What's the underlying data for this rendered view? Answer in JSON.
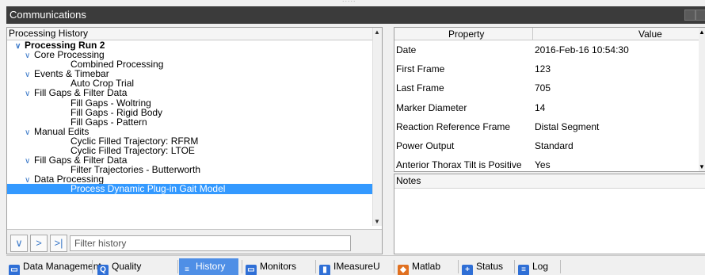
{
  "window": {
    "title": "Communications"
  },
  "history": {
    "header": "Processing History",
    "rows": [
      {
        "label": "Processing Run 2",
        "level": 0,
        "expand": true,
        "bold": true
      },
      {
        "label": "Core Processing",
        "level": 1,
        "expand": true
      },
      {
        "label": "Combined Processing",
        "level": 2
      },
      {
        "label": "Events & Timebar",
        "level": 1,
        "expand": true
      },
      {
        "label": "Auto Crop Trial",
        "level": 2
      },
      {
        "label": "Fill Gaps & Filter Data",
        "level": 1,
        "expand": true
      },
      {
        "label": "Fill Gaps - Woltring",
        "level": 2
      },
      {
        "label": "Fill Gaps - Rigid Body",
        "level": 2
      },
      {
        "label": "Fill Gaps - Pattern",
        "level": 2
      },
      {
        "label": "Manual Edits",
        "level": 1,
        "expand": true
      },
      {
        "label": "Cyclic Filled Trajectory:  RFRM",
        "level": 2
      },
      {
        "label": "Cyclic Filled Trajectory:  LTOE",
        "level": 2
      },
      {
        "label": "Fill Gaps & Filter Data",
        "level": 1,
        "expand": true
      },
      {
        "label": "Filter Trajectories - Butterworth",
        "level": 2
      },
      {
        "label": "Data Processing",
        "level": 1,
        "expand": true
      },
      {
        "label": "Process Dynamic Plug-in Gait Model",
        "level": 2,
        "selected": true
      }
    ],
    "filter_placeholder": "Filter history"
  },
  "properties": {
    "col_property": "Property",
    "col_value": "Value",
    "rows": [
      {
        "key": "Date",
        "value": "2016-Feb-16 10:54:30"
      },
      {
        "key": "First Frame",
        "value": "123"
      },
      {
        "key": "Last Frame",
        "value": "705"
      },
      {
        "key": "Marker Diameter",
        "value": "14"
      },
      {
        "key": "Reaction Reference Frame",
        "value": "Distal Segment"
      },
      {
        "key": "Power Output",
        "value": "Standard"
      },
      {
        "key": "Anterior Thorax Tilt is Positive",
        "value": "Yes"
      }
    ]
  },
  "notes": {
    "header": "Notes"
  },
  "tabs": [
    {
      "label": "Data Management",
      "icon": "data-management-icon",
      "color": "#2f6fd6"
    },
    {
      "label": "Quality",
      "icon": "quality-icon",
      "color": "#2f6fd6"
    },
    {
      "label": "History",
      "icon": "history-icon",
      "color": "#ffffff",
      "active": true
    },
    {
      "label": "Monitors",
      "icon": "monitors-icon",
      "color": "#2f6fd6"
    },
    {
      "label": "IMeasureU",
      "icon": "imeasureu-icon",
      "color": "#2f6fd6"
    },
    {
      "label": "Matlab",
      "icon": "matlab-icon",
      "color": "#e07020"
    },
    {
      "label": "Status",
      "icon": "status-icon",
      "color": "#2f6fd6"
    },
    {
      "label": "Log",
      "icon": "log-icon",
      "color": "#2f6fd6"
    }
  ],
  "colors": {
    "selection": "#3399ff",
    "active_tab": "#4f8fe6",
    "titlebar": "#3b3b3b"
  }
}
